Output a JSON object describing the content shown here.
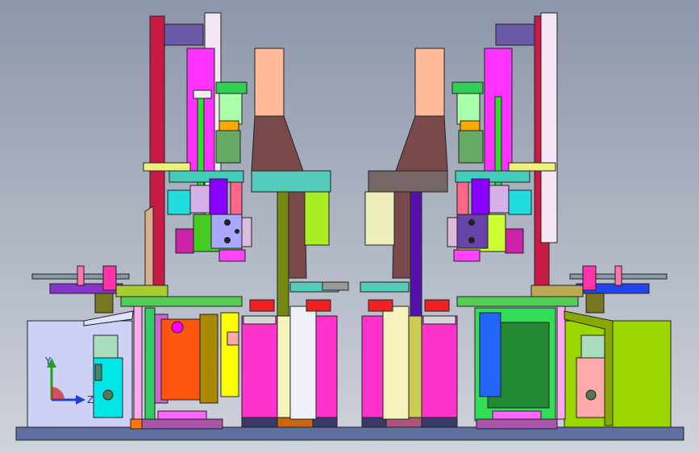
{
  "viewport": {
    "background_top": "#8d97aa",
    "background_bottom": "#cbd0d8"
  },
  "triad": {
    "y_label": "Y",
    "z_label": "Z",
    "y_color": "#20a020",
    "z_color": "#2040d0",
    "origin_color": "#d02020"
  },
  "machine": {
    "frame_color": "#5a6a9a",
    "accent_colors": [
      "#ff00ff",
      "#00e0e0",
      "#ffff00",
      "#00c000",
      "#ff6000",
      "#8000ff"
    ]
  }
}
